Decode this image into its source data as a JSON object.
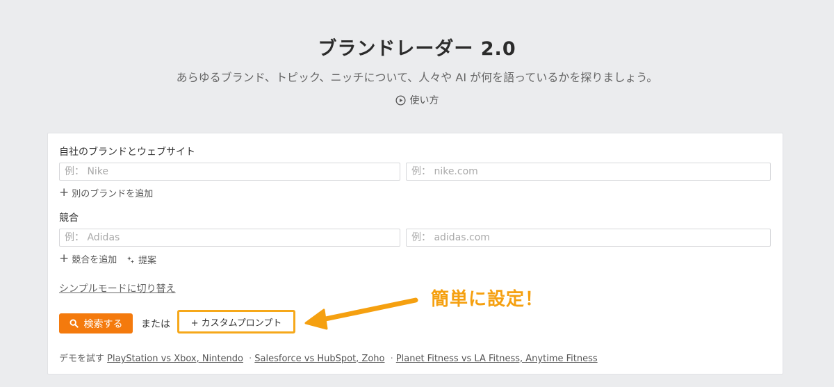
{
  "header": {
    "title": "ブランドレーダー 2.0",
    "subtitle": "あらゆるブランド、トピック、ニッチについて、人々や AI が何を語っているかを探りましょう。",
    "howto_label": "使い方"
  },
  "form": {
    "own_brand": {
      "label": "自社のブランドとウェブサイト",
      "brand_placeholder": "例： Nike",
      "site_placeholder": "例： nike.com",
      "add_label": "別のブランドを追加"
    },
    "competitors": {
      "label": "競合",
      "brand_placeholder": "例： Adidas",
      "site_placeholder": "例： adidas.com",
      "add_label": "競合を追加",
      "suggest_label": "提案"
    },
    "simple_mode_link": "シンプルモードに切り替え",
    "search_button": "検索する",
    "or_text": "または",
    "custom_prompt_button": "+ カスタムプロンプト",
    "demo": {
      "prefix": "デモを試す",
      "links": [
        "PlayStation vs Xbox, Nintendo",
        "Salesforce vs HubSpot, Zoho",
        "Planet Fitness vs LA Fitness, Anytime Fitness"
      ],
      "separator": "·"
    }
  },
  "annotation": {
    "text": "簡単に設定！",
    "color": "#f5a010"
  },
  "colors": {
    "accent": "#f47a0d",
    "highlight_border": "#f6a81a",
    "background": "#ebecee"
  }
}
